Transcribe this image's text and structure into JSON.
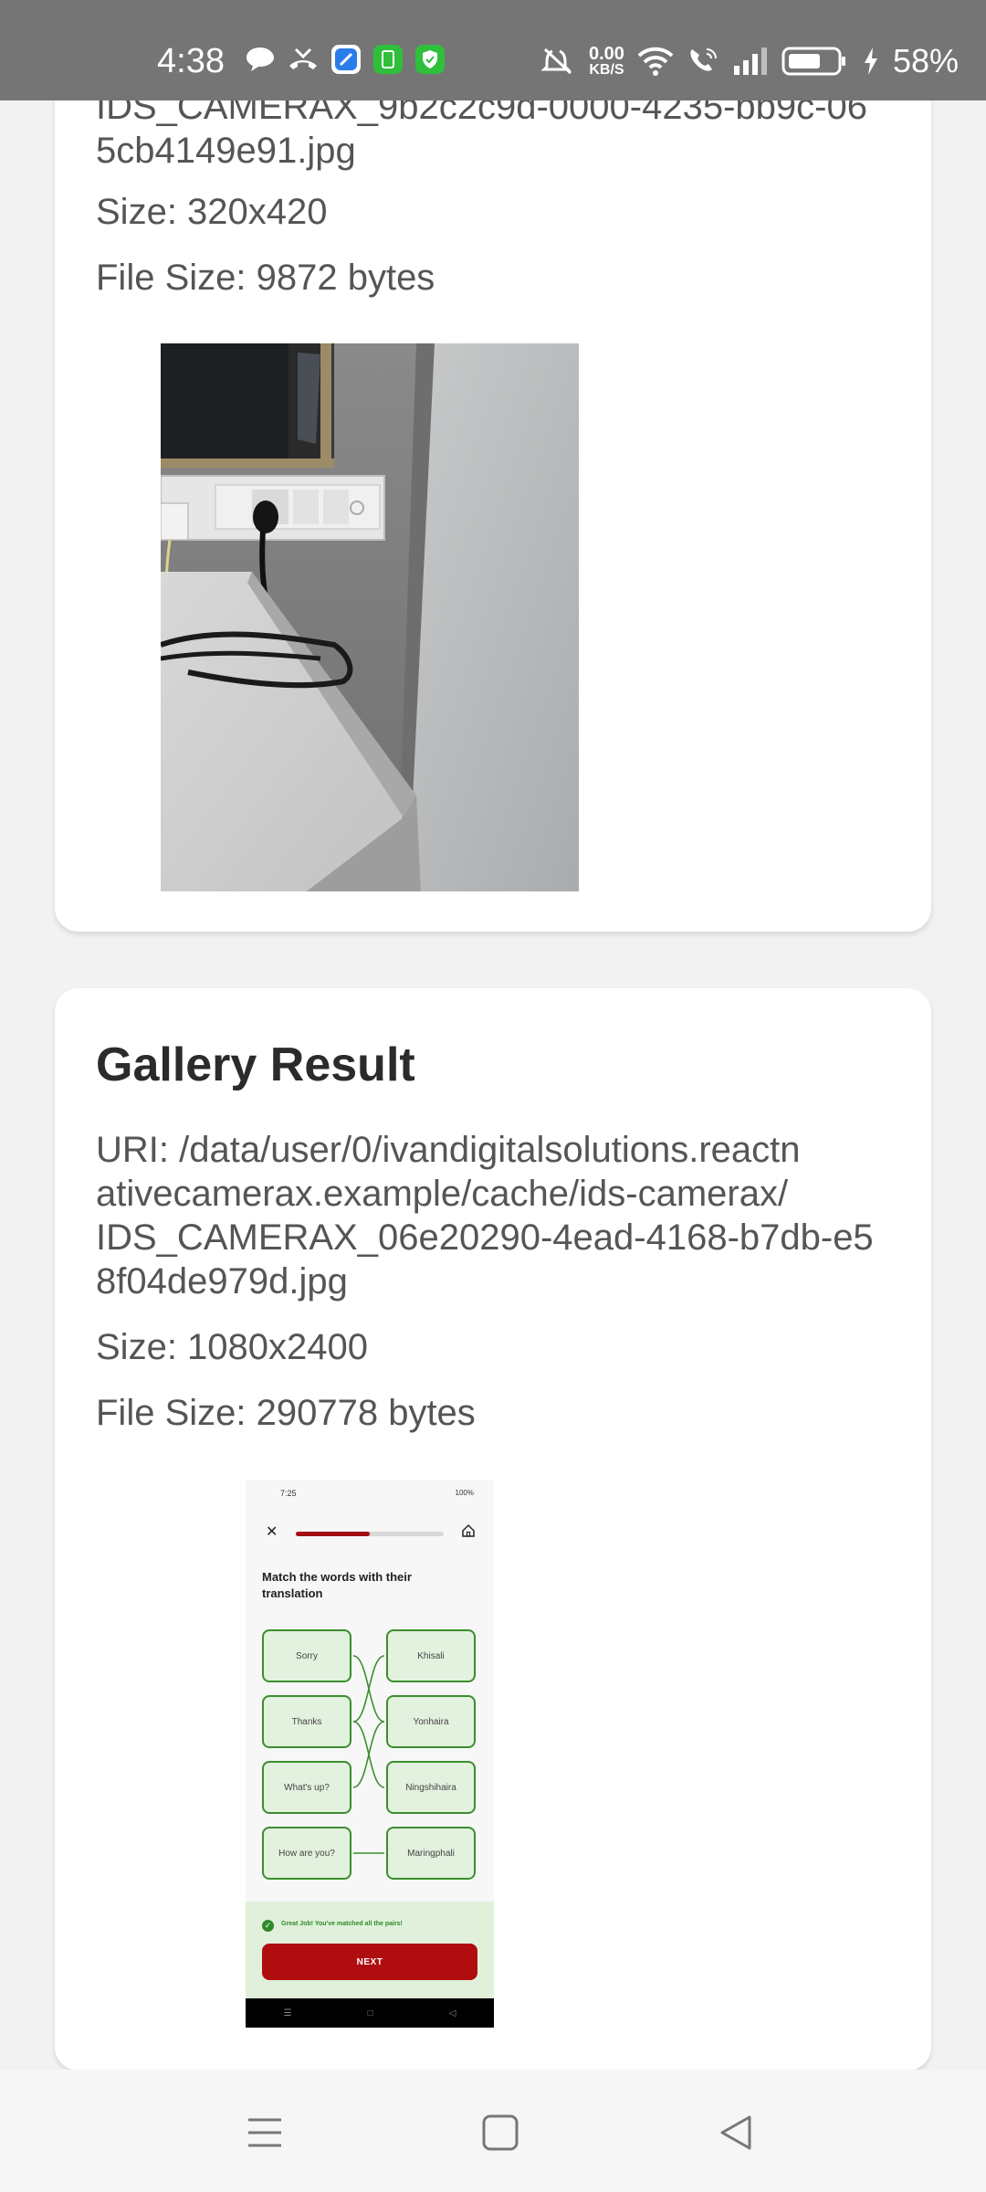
{
  "status_bar": {
    "time": "4:38",
    "net_speed_value": "0.00",
    "net_speed_unit": "KB/S",
    "battery_pct": "58%"
  },
  "capture_card": {
    "filename_tail": "IDS_CAMERAX_9b2c2c9d-0000-4235-bb9c-065cb4149e91.jpg",
    "filename_line1": "IDS_CAMERAX_9b2c2c9d-0000-4235-bb9c-06",
    "filename_line2": "5cb4149e91.jpg",
    "size": "Size: 320x420",
    "file_size": "File Size: 9872 bytes"
  },
  "gallery_card": {
    "title": "Gallery Result",
    "uri_line1": "URI: /data/user/0/ivandigitalsolutions.reactn",
    "uri_line2": "ativecamerax.example/cache/ids-camerax/",
    "uri_line3": "IDS_CAMERAX_06e20290-4ead-4168-b7db-e5",
    "uri_line4": "8f04de979d.jpg",
    "size": "Size: 1080x2400",
    "file_size": "File Size: 290778 bytes"
  },
  "thumbnail": {
    "time": "7:25",
    "battery": "100%",
    "question": "Match the words with their translation",
    "left_words": [
      "Sorry",
      "Thanks",
      "What's up?",
      "How are you?"
    ],
    "right_words": [
      "Khisali",
      "Yonhaira",
      "Ningshihaira",
      "Maringphali"
    ],
    "feedback": "Great Job! You've matched all the pairs!",
    "next_label": "NEXT",
    "progress": 0.5
  }
}
